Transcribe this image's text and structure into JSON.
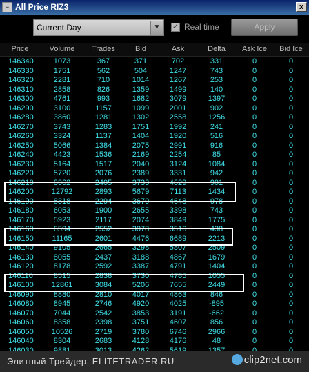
{
  "window": {
    "title": "All Price RIZ3",
    "close_label": "x"
  },
  "toolbar": {
    "period": "Current Day",
    "realtime_label": "Real time",
    "realtime_checked": true,
    "apply_label": "Apply"
  },
  "table": {
    "columns": [
      "Price",
      "Volume",
      "Trades",
      "Bid",
      "Ask",
      "Delta",
      "Ask Ice",
      "Bid Ice"
    ],
    "rows": [
      [
        "146340",
        "1073",
        "367",
        "371",
        "702",
        "331",
        "0",
        "0"
      ],
      [
        "146330",
        "1751",
        "562",
        "504",
        "1247",
        "743",
        "0",
        "0"
      ],
      [
        "146320",
        "2281",
        "710",
        "1014",
        "1267",
        "253",
        "0",
        "0"
      ],
      [
        "146310",
        "2858",
        "826",
        "1359",
        "1499",
        "140",
        "0",
        "0"
      ],
      [
        "146300",
        "4761",
        "993",
        "1682",
        "3079",
        "1397",
        "0",
        "0"
      ],
      [
        "146290",
        "3100",
        "1157",
        "1099",
        "2001",
        "902",
        "0",
        "0"
      ],
      [
        "146280",
        "3860",
        "1281",
        "1302",
        "2558",
        "1256",
        "0",
        "0"
      ],
      [
        "146270",
        "3743",
        "1283",
        "1751",
        "1992",
        "241",
        "0",
        "0"
      ],
      [
        "146260",
        "3324",
        "1137",
        "1404",
        "1920",
        "516",
        "0",
        "0"
      ],
      [
        "146250",
        "5066",
        "1384",
        "2075",
        "2991",
        "916",
        "0",
        "0"
      ],
      [
        "146240",
        "4423",
        "1536",
        "2169",
        "2254",
        "85",
        "0",
        "0"
      ],
      [
        "146230",
        "5164",
        "1517",
        "2040",
        "3124",
        "1084",
        "0",
        "0"
      ],
      [
        "146220",
        "5720",
        "2076",
        "2389",
        "3331",
        "942",
        "0",
        "0"
      ],
      [
        "146210",
        "8362",
        "2405",
        "3733",
        "4629",
        "901",
        "0",
        "0"
      ],
      [
        "146200",
        "12792",
        "2893",
        "5679",
        "7113",
        "1434",
        "0",
        "0"
      ],
      [
        "146190",
        "8318",
        "2294",
        "3670",
        "4648",
        "978",
        "0",
        "0"
      ],
      [
        "146180",
        "6053",
        "1900",
        "2655",
        "3398",
        "743",
        "0",
        "0"
      ],
      [
        "146170",
        "5923",
        "2117",
        "2074",
        "3849",
        "1775",
        "0",
        "0"
      ],
      [
        "146160",
        "6594",
        "2552",
        "3078",
        "3516",
        "438",
        "0",
        "0"
      ],
      [
        "146150",
        "11165",
        "2601",
        "4476",
        "6689",
        "2213",
        "0",
        "0"
      ],
      [
        "146140",
        "9105",
        "2665",
        "3298",
        "5807",
        "2509",
        "0",
        "0"
      ],
      [
        "146130",
        "8055",
        "2437",
        "3188",
        "4867",
        "1679",
        "0",
        "0"
      ],
      [
        "146120",
        "8178",
        "2592",
        "3387",
        "4791",
        "1404",
        "0",
        "0"
      ],
      [
        "146110",
        "8515",
        "2838",
        "3730",
        "4785",
        "1055",
        "0",
        "0"
      ],
      [
        "146100",
        "12861",
        "3084",
        "5206",
        "7655",
        "2449",
        "0",
        "0"
      ],
      [
        "146090",
        "8880",
        "2810",
        "4017",
        "4863",
        "846",
        "0",
        "0"
      ],
      [
        "146080",
        "8945",
        "2746",
        "4920",
        "4025",
        "-895",
        "0",
        "0"
      ],
      [
        "146070",
        "7044",
        "2542",
        "3853",
        "3191",
        "-662",
        "0",
        "0"
      ],
      [
        "146060",
        "8358",
        "2398",
        "3751",
        "4607",
        "856",
        "0",
        "0"
      ],
      [
        "146050",
        "10526",
        "2719",
        "3780",
        "6746",
        "2966",
        "0",
        "0"
      ],
      [
        "146040",
        "8304",
        "2683",
        "4128",
        "4176",
        "48",
        "0",
        "0"
      ],
      [
        "146030",
        "9881",
        "3013",
        "4262",
        "5619",
        "1357",
        "0",
        "0"
      ]
    ]
  },
  "footer": {
    "watermark": "Элитный Трейдер, ELITETRADER.RU",
    "brand": "clip2net.com"
  },
  "colors": {
    "cell_text": "#3fe0e8",
    "header_text": "#b8b8b8",
    "background": "#000000"
  }
}
